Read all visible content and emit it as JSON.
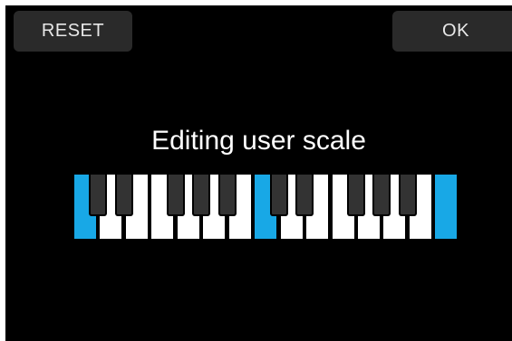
{
  "header": {
    "reset_label": "RESET",
    "ok_label": "OK"
  },
  "title": "Editing user scale",
  "keyboard": {
    "white_keys": [
      {
        "note": "C",
        "active": true
      },
      {
        "note": "D",
        "active": false
      },
      {
        "note": "E",
        "active": false
      },
      {
        "note": "F",
        "active": false
      },
      {
        "note": "G",
        "active": false
      },
      {
        "note": "A",
        "active": false
      },
      {
        "note": "B",
        "active": false
      },
      {
        "note": "C",
        "active": true
      },
      {
        "note": "D",
        "active": false
      },
      {
        "note": "E",
        "active": false
      },
      {
        "note": "F",
        "active": false
      },
      {
        "note": "G",
        "active": false
      },
      {
        "note": "A",
        "active": false
      },
      {
        "note": "B",
        "active": false
      },
      {
        "note": "C",
        "active": true
      }
    ],
    "black_keys": [
      {
        "note": "C#",
        "active": false
      },
      {
        "note": "D#",
        "active": false
      },
      {
        "note": "F#",
        "active": false
      },
      {
        "note": "G#",
        "active": false
      },
      {
        "note": "A#",
        "active": false
      },
      {
        "note": "C#",
        "active": false
      },
      {
        "note": "D#",
        "active": false
      },
      {
        "note": "F#",
        "active": false
      },
      {
        "note": "G#",
        "active": false
      },
      {
        "note": "A#",
        "active": false
      }
    ],
    "colors": {
      "active": "#18a8e6",
      "white": "#ffffff",
      "black": "#333333"
    }
  }
}
